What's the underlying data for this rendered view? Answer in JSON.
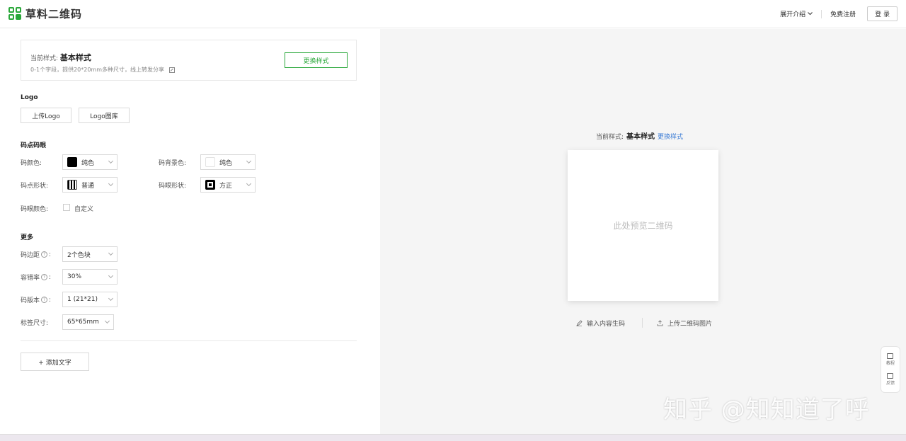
{
  "header": {
    "brand": "草料二维码",
    "nav": {
      "features": "展开介绍",
      "register": "免费注册",
      "login": "登 录"
    }
  },
  "style_card": {
    "label": "当前样式:",
    "name": "基本样式",
    "desc": "0-1个字段，提供20*20mm多种尺寸，线上转发分享",
    "change_button": "更换样式"
  },
  "logo_section": {
    "title": "Logo",
    "upload": "上传Logo",
    "gallery": "Logo图库"
  },
  "dots_section": {
    "title": "码点码眼",
    "dot_color_label": "码颜色:",
    "dot_color_value": "纯色",
    "bg_color_label": "码背景色:",
    "bg_color_value": "纯色",
    "dot_shape_label": "码点形状:",
    "dot_shape_value": "普通",
    "eye_shape_label": "码眼形状:",
    "eye_shape_value": "方正",
    "eye_color_label": "码眼颜色:",
    "eye_color_custom": "自定义"
  },
  "more_section": {
    "title": "更多",
    "margin_label": "码边距",
    "margin_value": "2个色块",
    "error_label": "容错率",
    "error_value": "30%",
    "version_label": "码版本",
    "version_value": "1 (21*21)",
    "size_label": "标签尺寸:",
    "size_value": "65*65mm",
    "help_glyph": "?",
    "colon": ":"
  },
  "add_text_button": "+ 添加文字",
  "preview": {
    "label": "当前样式:",
    "name": "基本样式",
    "change_link": "更换样式",
    "placeholder": "此处预览二维码",
    "action_input": "输入内容生码",
    "action_upload": "上传二维码图片"
  },
  "float_bar": {
    "tutorial": "教程",
    "feedback": "反馈"
  },
  "watermark": "知乎 @知知道了呼",
  "colors": {
    "accent_green": "#2aa83a",
    "link_blue": "#3a7bd5",
    "panel_bg": "#f5f5f5"
  }
}
